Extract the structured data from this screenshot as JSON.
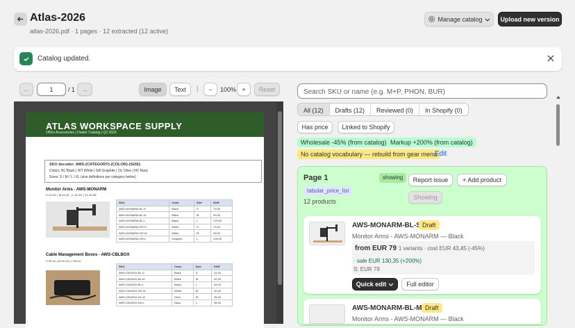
{
  "header": {
    "title": "Atlas-2026",
    "subtitle": "atlas-2026.pdf · 1 pages · 12 extracted (12 active)",
    "manage_label": "Manage catalog",
    "upload_label": "Upload new version"
  },
  "banner": {
    "text": "Catalog updated."
  },
  "toolbar": {
    "page_value": "1",
    "page_total": "/ 1",
    "image_label": "Image",
    "text_label": "Text",
    "zoom_out": "−",
    "zoom": "100%",
    "zoom_in": "+",
    "reset": "Reset"
  },
  "pdf": {
    "title": "ATLAS WORKSPACE SUPPLY",
    "subtitle": "Office Accessories | Dealer Catalog | Q2 2026",
    "decoder_title": "SKU decoder:  AWS-{CATEGORY}-{COLOR}-{SIZE}",
    "decoder_colors": "Colors:   BL Black  |  WT White  |  GR Graphite  |  OL Olive  |  NV Navy",
    "decoder_sizes": "Sizes:   S / M / L / XL   (size definitions per category below)",
    "s1_title": "Monitor Arms  -  AWS-MONARM",
    "s1_sizes": "S 13-24\"  |  M 24-32\"  |  L 32-43\"  |  XL 43-55\"",
    "s2_title": "Cable Management Boxes  -  AWS-CBLBOX",
    "s2_sizes": "S 30 cm  |  M 40 cm  |  L 55 cm",
    "headers": [
      "SKU",
      "Color",
      "Size",
      "EUR"
    ],
    "t1": [
      [
        "AWS-MONARM-BL-S",
        "Black",
        "S",
        "79,00"
      ],
      [
        "AWS-MONARM-BL-M",
        "Black",
        "M",
        "99,00"
      ],
      [
        "AWS-MONARM-BL-L",
        "Black",
        "L",
        "129,00"
      ],
      [
        "AWS-MONARM-WT-S",
        "White",
        "S",
        "79,00"
      ],
      [
        "AWS-MONARM-WT-M",
        "White",
        "M",
        "99,00"
      ],
      [
        "AWS-MONARM-GR-L",
        "Graphite",
        "L",
        "139,00"
      ]
    ],
    "t2": [
      [
        "AWS-CBLBOX-BL-S",
        "Black",
        "S",
        "24,00"
      ],
      [
        "AWS-CBLBOX-BL-M",
        "Black",
        "M",
        "32,00"
      ],
      [
        "AWS-CBLBOX-BL-L",
        "Black",
        "L",
        "44,00"
      ],
      [
        "AWS-CBLBOX-WT-M",
        "White",
        "M",
        "32,00"
      ],
      [
        "AWS-CBLBOX-OL-M",
        "Olive",
        "M",
        "36,00"
      ],
      [
        "AWS-CBLBOX-NV-L",
        "Navy",
        "L",
        "48,00"
      ]
    ]
  },
  "right": {
    "search_placeholder": "Search SKU or name (e.g. M+P, PHON, BUR)",
    "tabs": [
      "All (12)",
      "Drafts (12)",
      "Reviewed (0)",
      "In Shopify (0)"
    ],
    "has_price": "Has price",
    "linked": "Linked to Shopify",
    "wholesale": "Wholesale -45% (from catalog)",
    "markup": "Markup +200% (from catalog)",
    "no_vocab": "No catalog vocabulary — rebuild from gear menu",
    "edit": "Edit",
    "page_title": "Page 1",
    "showing_badge": "showing",
    "report": "Report issue",
    "add_product": "+ Add product",
    "tag": "tabular_price_list",
    "products": "12 products",
    "showing_btn": "Showing",
    "p1": {
      "sku": "AWS-MONARM-BL-S",
      "status": "Draft",
      "name": "Monitor Arms - AWS-MONARM — Black",
      "from": "from EUR 79",
      "meta": "· 1 variants  · cost EUR 43,45 (-45%)",
      "sale": "· sale EUR 130,35 (+200%)",
      "size": "S: EUR 79",
      "quick": "Quick edit",
      "full": "Full editor"
    },
    "p2": {
      "sku": "AWS-MONARM-BL-M",
      "status": "Draft",
      "name": "Monitor Arms - AWS-MONARM — Black"
    }
  }
}
